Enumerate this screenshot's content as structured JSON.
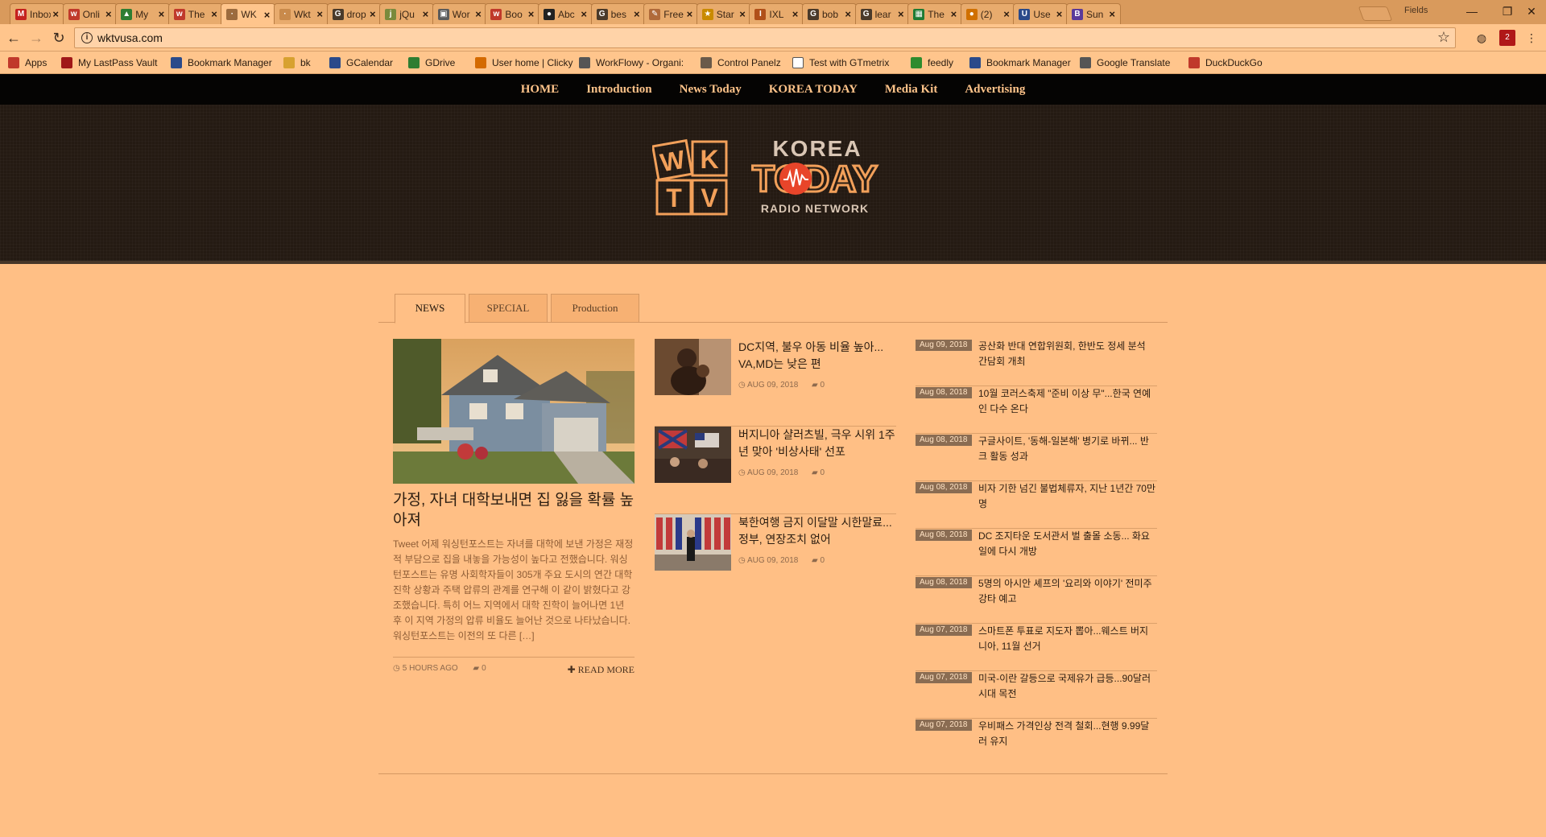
{
  "browser": {
    "tabs": [
      {
        "title": "Inbox",
        "icon": "gmail-icon",
        "color": "#c5221f",
        "glyph": "M"
      },
      {
        "title": "Onli",
        "icon": "w-icon",
        "color": "#c0392b",
        "glyph": "w"
      },
      {
        "title": "My",
        "icon": "drive-icon",
        "color": "#2e7d32",
        "glyph": "▲"
      },
      {
        "title": "The",
        "icon": "w-icon",
        "color": "#c0392b",
        "glyph": "w"
      },
      {
        "title": "WK",
        "icon": "page-icon",
        "color": "#9c6b3e",
        "glyph": "·"
      },
      {
        "title": "Wkt",
        "icon": "page-icon",
        "color": "#c98a4b",
        "glyph": "·"
      },
      {
        "title": "drop",
        "icon": "google-icon",
        "color": "#4a3a2a",
        "glyph": "G"
      },
      {
        "title": "jQu",
        "icon": "jquery-icon",
        "color": "#7a8a3c",
        "glyph": "j"
      },
      {
        "title": "Wor",
        "icon": "page-icon",
        "color": "#5b5b5b",
        "glyph": "▣"
      },
      {
        "title": "Boo",
        "icon": "w-icon",
        "color": "#c0392b",
        "glyph": "w"
      },
      {
        "title": "Abc",
        "icon": "github-icon",
        "color": "#222",
        "glyph": "●"
      },
      {
        "title": "bes",
        "icon": "google-icon",
        "color": "#4a3a2a",
        "glyph": "G"
      },
      {
        "title": "Free",
        "icon": "page-icon",
        "color": "#b06a3a",
        "glyph": "✎"
      },
      {
        "title": "Star",
        "icon": "star-icon",
        "color": "#c98a00",
        "glyph": "★"
      },
      {
        "title": "IXL",
        "icon": "ixl-icon",
        "color": "#b0501a",
        "glyph": "I"
      },
      {
        "title": "bob",
        "icon": "google-icon",
        "color": "#4a3a2a",
        "glyph": "G"
      },
      {
        "title": "lear",
        "icon": "google-icon",
        "color": "#4a3a2a",
        "glyph": "G"
      },
      {
        "title": "The",
        "icon": "sheets-icon",
        "color": "#1e7b34",
        "glyph": "▦"
      },
      {
        "title": "(2)",
        "icon": "notification-icon",
        "color": "#d07000",
        "glyph": "●"
      },
      {
        "title": "Use",
        "icon": "u-icon",
        "color": "#2a4a8a",
        "glyph": "U"
      },
      {
        "title": "Sun",
        "icon": "booking-icon",
        "color": "#5a3a9a",
        "glyph": "B"
      }
    ],
    "profile_label": "Fields",
    "url": "wktvusa.com",
    "bookmarks": [
      {
        "label": "Apps",
        "icon": "apps-icon",
        "color": "#c0392b"
      },
      {
        "label": "My LastPass Vault",
        "icon": "lastpass-icon",
        "color": "#a01818"
      },
      {
        "label": "Bookmark Manager",
        "icon": "star-icon",
        "color": "#2a4a8a"
      },
      {
        "label": "bk",
        "icon": "folder-icon",
        "color": "#d7a130"
      },
      {
        "label": "GCalendar",
        "icon": "calendar-icon",
        "color": "#2a4a8a"
      },
      {
        "label": "GDrive",
        "icon": "drive-icon",
        "color": "#2e7d32"
      },
      {
        "label": "User home | Clicky",
        "icon": "clicky-icon",
        "color": "#d46a00"
      },
      {
        "label": "WorkFlowy - Organi:",
        "icon": "workflowy-icon",
        "color": "#555"
      },
      {
        "label": "Control Panelz",
        "icon": "box-icon",
        "color": "#6a5a4a"
      },
      {
        "label": "Test with GTmetrix",
        "icon": "page-icon",
        "color": "#ffffff"
      },
      {
        "label": "feedly",
        "icon": "feedly-icon",
        "color": "#2e8b2e"
      },
      {
        "label": "Bookmark Manager",
        "icon": "star-icon",
        "color": "#2a4a8a"
      },
      {
        "label": "Google Translate",
        "icon": "translate-icon",
        "color": "#555"
      },
      {
        "label": "DuckDuckGo",
        "icon": "duckduckgo-icon",
        "color": "#c0392b"
      }
    ],
    "extension_badge": "2"
  },
  "site": {
    "nav": [
      "HOME",
      "Introduction",
      "News Today",
      "KOREA TODAY",
      "Media Kit",
      "Advertising"
    ],
    "logo": {
      "letters": [
        "W",
        "K",
        "T",
        "V"
      ],
      "line1": "KOREA",
      "line2": "TODAY",
      "line3": "RADIO NETWORK"
    },
    "tabs": [
      "NEWS",
      "SPECIAL",
      "Production"
    ],
    "feature": {
      "title": "가정, 자녀 대학보내면 집 잃을 확률 높아져",
      "excerpt": "Tweet 어제 워싱턴포스트는 자녀를 대학에 보낸 가정은 재정적 부담으로 집을 내놓을 가능성이 높다고 전했습니다. 워싱턴포스트는 유명 사회학자들이 305개 주요 도시의 연간 대학진학 상황과 주택 압류의 관계를 연구해 이 같이 밝혔다고 강조했습니다. 특히 어느 지역에서 대학 진학이 늘어나면 1년 후 이 지역 가정의 압류 비율도 늘어난 것으로 나타났습니다. 워싱턴포스트는 이전의 또 다른 […]",
      "time": "5 HOURS AGO",
      "comments": "0",
      "read_more": "READ MORE"
    },
    "middle": [
      {
        "title": "DC지역, 불우 아동 비율 높아... VA,MD는 낮은 편",
        "date": "AUG 09, 2018",
        "comments": "0"
      },
      {
        "title": "버지니아 샬러츠빌, 극우 시위 1주년 맞아 '비상사태' 선포",
        "date": "AUG 09, 2018",
        "comments": "0"
      },
      {
        "title": "북한여행 금지 이달말 시한말료...정부, 연장조치 없어",
        "date": "AUG 09, 2018",
        "comments": "0"
      }
    ],
    "right": [
      {
        "date": "Aug 09, 2018",
        "title": "공산화 반대 연합위원회, 한반도 정세 분석 간담회 개최"
      },
      {
        "date": "Aug 08, 2018",
        "title": "10월 코러스축제 \"준비 이상 무\"...한국 연예인 다수 온다"
      },
      {
        "date": "Aug 08, 2018",
        "title": "구글사이트, '동해-일본해' 병기로 바뀌... 반크 활동 성과"
      },
      {
        "date": "Aug 08, 2018",
        "title": "비자 기한 넘긴 불법체류자, 지난 1년간 70만명"
      },
      {
        "date": "Aug 08, 2018",
        "title": "DC 조지타운 도서관서 벌 출몰 소동... 화요일에 다시 개방"
      },
      {
        "date": "Aug 08, 2018",
        "title": "5명의 아시안 셰프의 '요리와 이야기' 전미주 강타 예고"
      },
      {
        "date": "Aug 07, 2018",
        "title": "스마트폰 투표로 지도자 뽑아...웨스트 버지니아, 11월 선거"
      },
      {
        "date": "Aug 07, 2018",
        "title": "미국-이란 갈등으로 국제유가 급등...90달러 시대 목전"
      },
      {
        "date": "Aug 07, 2018",
        "title": "우비패스 가격인상 전격 철회...현행 9.99달러 유지"
      }
    ]
  }
}
